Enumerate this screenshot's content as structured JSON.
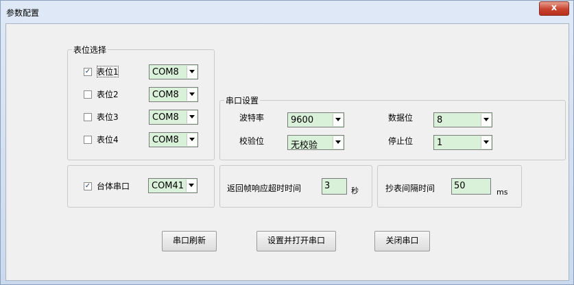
{
  "window": {
    "title": "参数配置",
    "close_label": "x"
  },
  "meter_select": {
    "legend": "表位选择",
    "items": [
      {
        "label": "表位1",
        "checked": true,
        "port": "COM8"
      },
      {
        "label": "表位2",
        "checked": false,
        "port": "COM8"
      },
      {
        "label": "表位3",
        "checked": false,
        "port": "COM8"
      },
      {
        "label": "表位4",
        "checked": false,
        "port": "COM8"
      }
    ]
  },
  "serial_settings": {
    "legend": "串口设置",
    "baud_label": "波特率",
    "baud_value": "9600",
    "parity_label": "校验位",
    "parity_value": "无校验",
    "databits_label": "数据位",
    "databits_value": "8",
    "stopbits_label": "停止位",
    "stopbits_value": "1"
  },
  "bench": {
    "label": "台体串口",
    "checked": true,
    "port": "COM41"
  },
  "timeout": {
    "label": "返回帧响应超时时间",
    "value": "3",
    "unit": "秒"
  },
  "interval": {
    "label": "抄表间隔时间",
    "value": "50",
    "unit": "ms"
  },
  "buttons": {
    "refresh": "串口刷新",
    "set_open": "设置并打开串口",
    "close": "关闭串口"
  }
}
